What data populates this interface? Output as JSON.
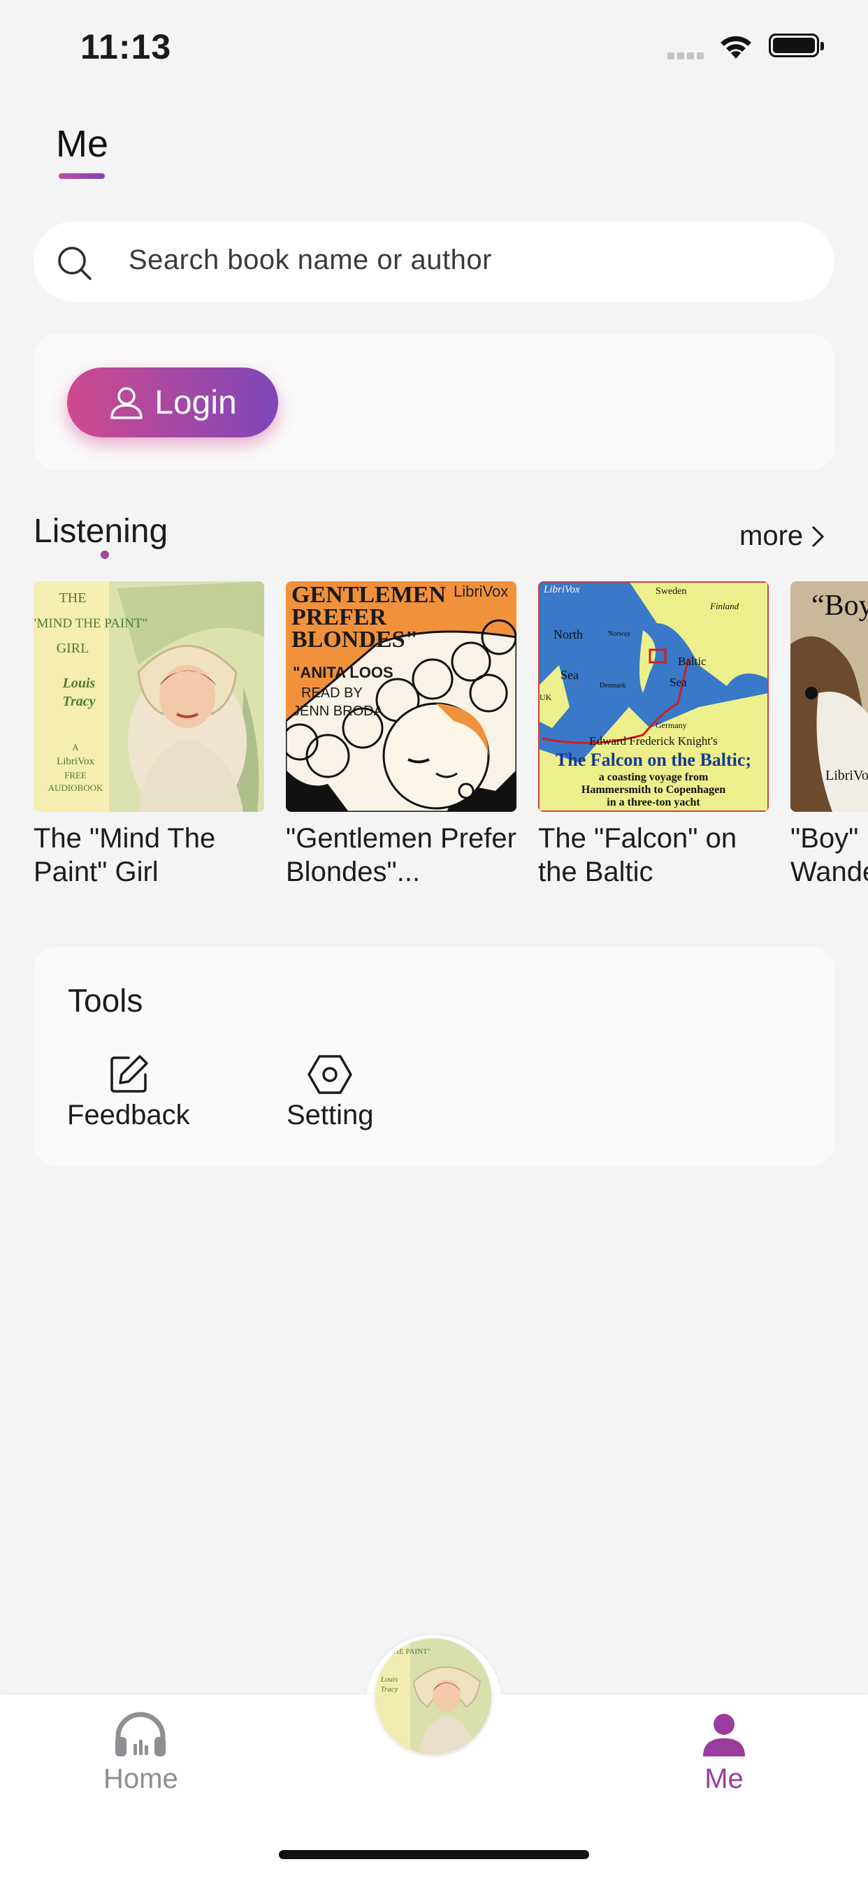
{
  "status_bar": {
    "time": "11:13"
  },
  "header": {
    "title": "Me"
  },
  "search": {
    "placeholder": "Search book name or author"
  },
  "login": {
    "label": "Login"
  },
  "listening": {
    "title": "Listening",
    "more_label": "more",
    "books": [
      {
        "title": "The \"Mind The Paint\" Girl",
        "cover": {
          "l1": "THE",
          "l2": "\"MIND THE PAINT\"",
          "l3": "GIRL",
          "l4": "Louis",
          "l5": "Tracy",
          "l6": "A",
          "l7": "LibriVox",
          "l8": "FREE",
          "l9": "AUDIOBOOK"
        }
      },
      {
        "title": "\"Gentlemen Prefer Blondes\"...",
        "cover": {
          "l1": "GENTLEMEN",
          "l2": "PREFER",
          "l3": "BLONDES\"",
          "l4": "\"ANITA LOOS",
          "l5": "READ BY",
          "l6": "JENN BRODA",
          "brand": "LibriVox"
        }
      },
      {
        "title": "The \"Falcon\" on the Baltic",
        "cover": {
          "brand": "LibriVox",
          "sweden": "Sweden",
          "finland": "Finland",
          "norway": "Norway",
          "north": "North",
          "sea1": "Sea",
          "baltic": "Baltic",
          "sea2": "Sea",
          "denmark": "Denmark",
          "uk": "UK",
          "germany": "Germany",
          "author": "Edward Frederick Knight's",
          "title": "The Falcon on the Baltic;",
          "sub1": "a coasting voyage from",
          "sub2": "Hammersmith to Copenhagen",
          "sub3": "in a three-ton yacht"
        }
      },
      {
        "title": "\"Boy\" Wande",
        "cover": {
          "quote": "“Boy",
          "brand": "LibriVo"
        }
      }
    ]
  },
  "tools": {
    "title": "Tools",
    "items": [
      {
        "label": "Feedback",
        "icon": "edit-icon"
      },
      {
        "label": "Setting",
        "icon": "hexagon-settings-icon"
      }
    ]
  },
  "tab_bar": {
    "items": [
      {
        "label": "Home",
        "icon": "headphones-icon",
        "active": false,
        "color": "#8e8e93"
      },
      {
        "label": "Me",
        "icon": "person-icon",
        "active": true,
        "color": "#9b3d9e"
      }
    ]
  },
  "colors": {
    "accent_start": "#d04a8e",
    "accent_end": "#7d47b8",
    "active_tab": "#9b3d9e"
  }
}
